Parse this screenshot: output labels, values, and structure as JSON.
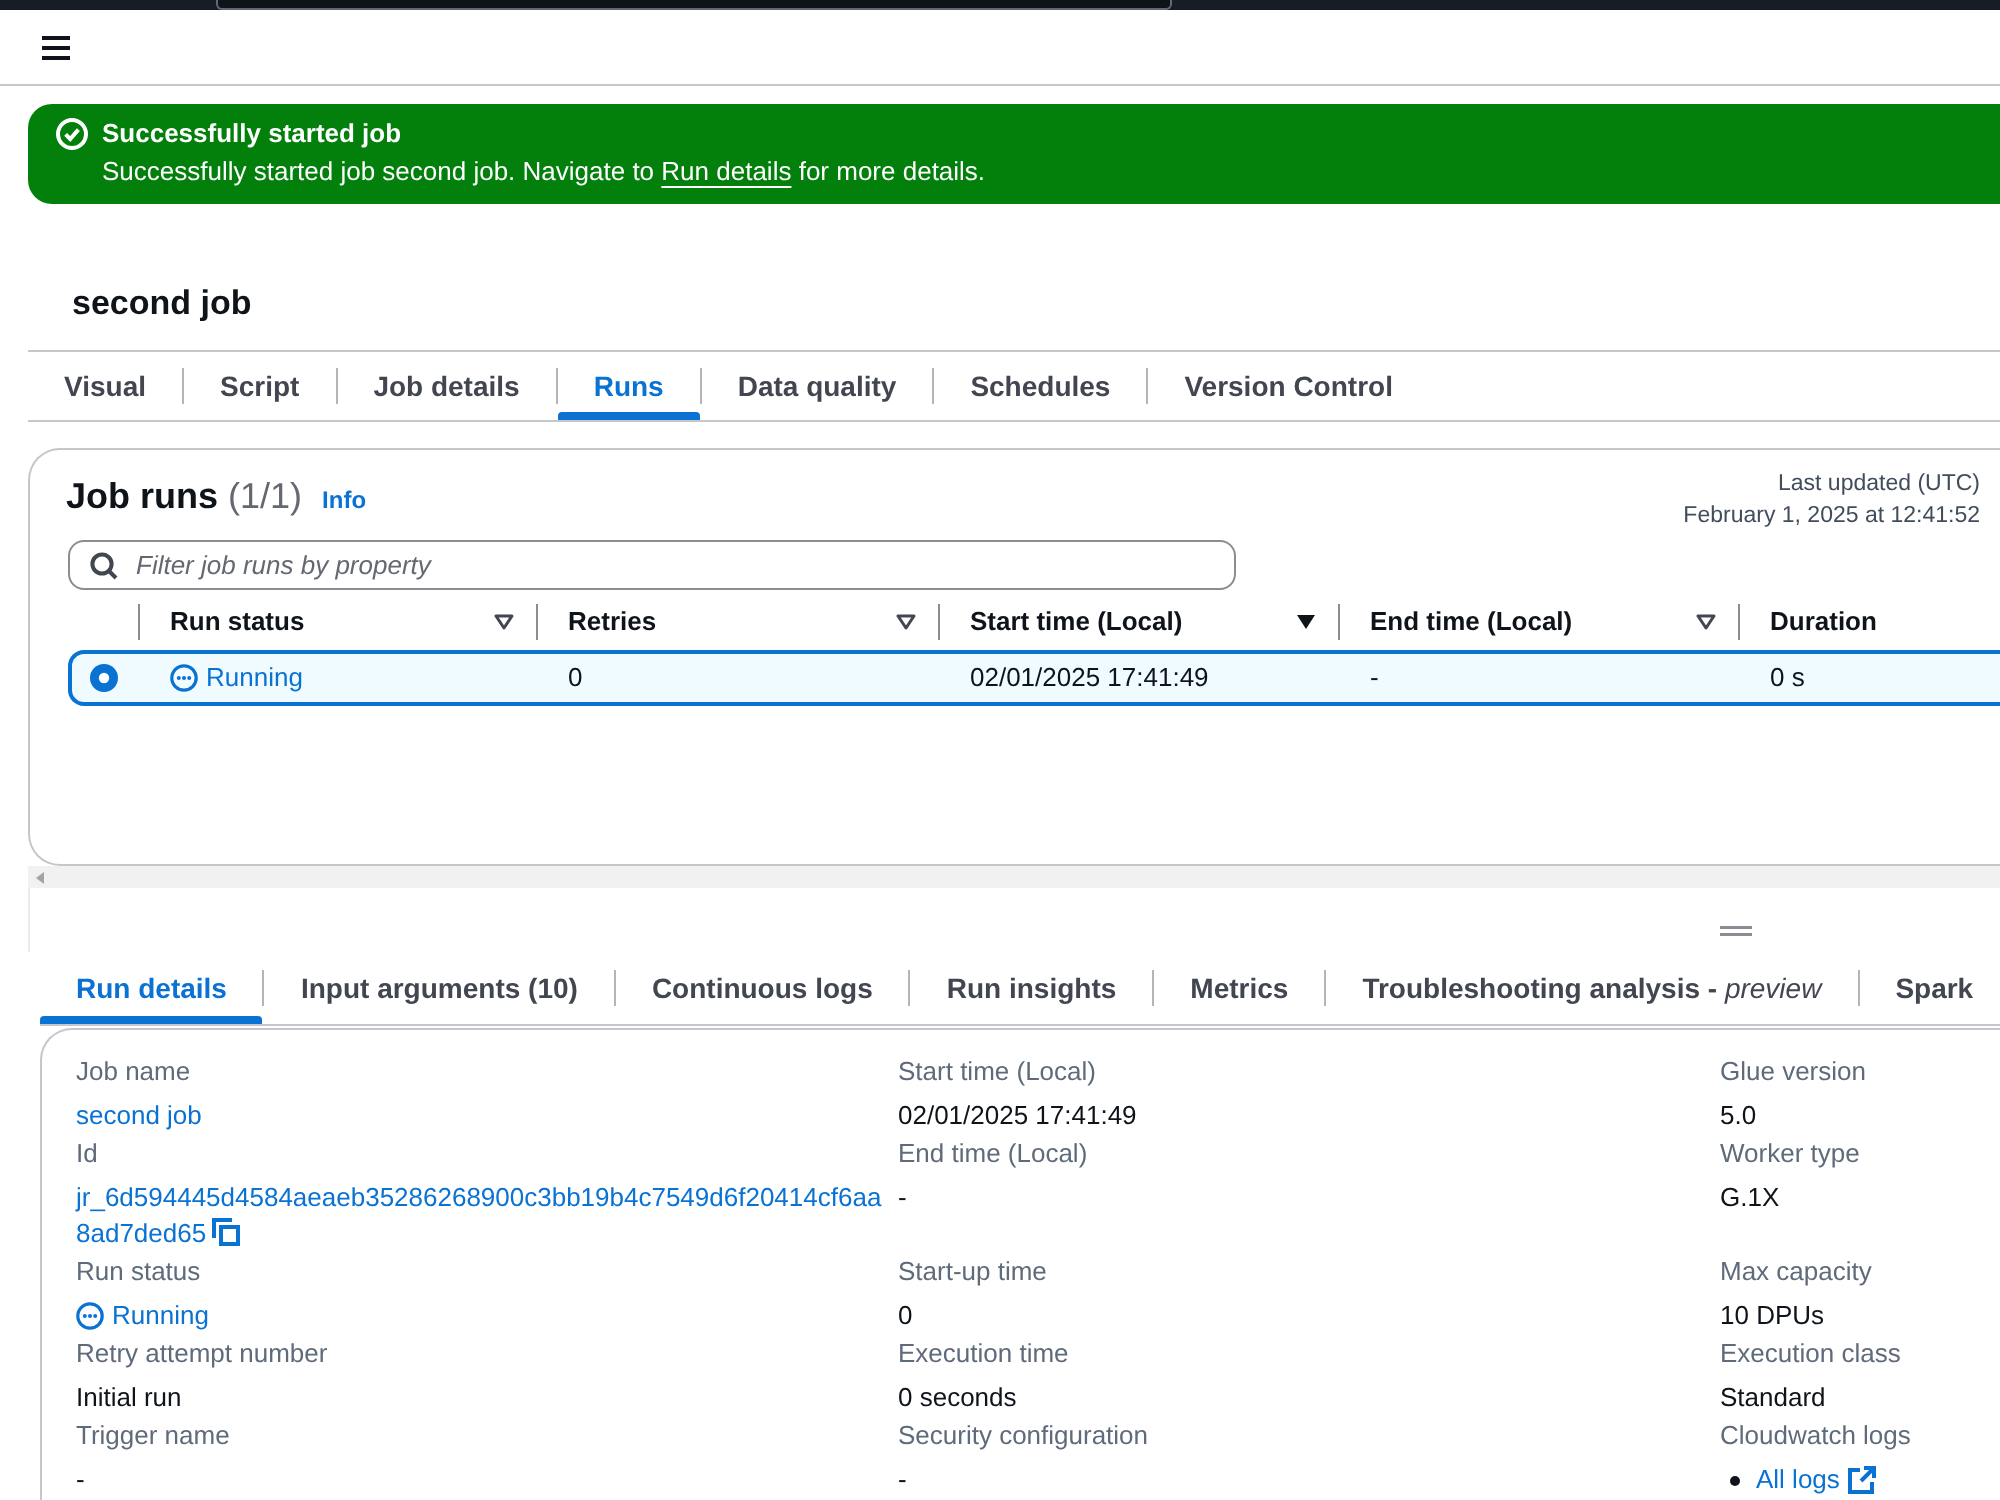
{
  "flash": {
    "title": "Successfully started job",
    "message": "Successfully started job second job. Navigate to",
    "link": "Run details",
    "message_end": "for more details."
  },
  "job": {
    "title": "second job"
  },
  "tabs": [
    {
      "label": "Visual",
      "selected": false
    },
    {
      "label": "Script",
      "selected": false
    },
    {
      "label": "Job details",
      "selected": false
    },
    {
      "label": "Runs",
      "selected": true
    },
    {
      "label": "Data quality",
      "selected": false
    },
    {
      "label": "Schedules",
      "selected": false
    },
    {
      "label": "Version Control",
      "selected": false
    }
  ],
  "job_runs": {
    "title": "Job runs",
    "count": "(1/1)",
    "info": "Info",
    "last_updated_label": "Last updated (UTC)",
    "last_updated": "February 1, 2025 at 12:41:52",
    "filter": {
      "placeholder": "Filter job runs by property"
    },
    "columns": [
      {
        "label": "Run status",
        "sorted": false
      },
      {
        "label": "Retries",
        "sorted": false
      },
      {
        "label": "Start time (Local)",
        "sorted": true
      },
      {
        "label": "End time (Local)",
        "sorted": false
      },
      {
        "label": "Duration"
      }
    ],
    "rows": [
      {
        "selected": true,
        "cells": [
          {
            "kind": "status",
            "text": "Running"
          },
          {
            "kind": "text",
            "text": "0"
          },
          {
            "kind": "text",
            "text": "02/01/2025 17:41:49"
          },
          {
            "kind": "text",
            "text": "-"
          },
          {
            "kind": "text",
            "text": "0 s"
          }
        ]
      }
    ]
  },
  "detail_tabs": [
    {
      "label": "Run details",
      "selected": true
    },
    {
      "label": "Input arguments (10)",
      "selected": false
    },
    {
      "label": "Continuous logs",
      "selected": false
    },
    {
      "label": "Run insights",
      "selected": false
    },
    {
      "label": "Metrics",
      "selected": false
    },
    {
      "label": "Troubleshooting analysis - *preview*",
      "selected": false
    },
    {
      "label": "Spark",
      "selected": false
    }
  ],
  "run_details": {
    "columns": [
      [
        {
          "label": "Job name",
          "kind": "link",
          "value": "second job"
        },
        {
          "label": "Id",
          "kind": "copyable_link",
          "value": "jr_6d594445d4584aeaeb35286268900c3bb19b4c7549d6f20414cf6aa8ad7ded65"
        },
        {
          "label": "Run status",
          "kind": "status",
          "value": "Running"
        },
        {
          "label": "Retry attempt number",
          "kind": "text",
          "value": "Initial run"
        },
        {
          "label": "Trigger name",
          "kind": "text",
          "value": "-"
        }
      ],
      [
        {
          "label": "Start time (Local)",
          "kind": "text",
          "value": "02/01/2025 17:41:49"
        },
        {
          "label": "End time (Local)",
          "kind": "text",
          "value": "-"
        },
        {
          "label": "Start-up time",
          "kind": "text",
          "value": "0"
        },
        {
          "label": "Execution time",
          "kind": "text",
          "value": "0 seconds"
        },
        {
          "label": "Security configuration",
          "kind": "text",
          "value": "-"
        }
      ],
      [
        {
          "label": "Glue version",
          "kind": "text",
          "value": "5.0"
        },
        {
          "label": "Worker type",
          "kind": "text",
          "value": "G.1X"
        },
        {
          "label": "Max capacity",
          "kind": "text",
          "value": "10 DPUs"
        },
        {
          "label": "Execution class",
          "kind": "text",
          "value": "Standard"
        },
        {
          "label": "Cloudwatch logs",
          "kind": "external_links",
          "links": [
            "All logs"
          ]
        }
      ]
    ]
  }
}
